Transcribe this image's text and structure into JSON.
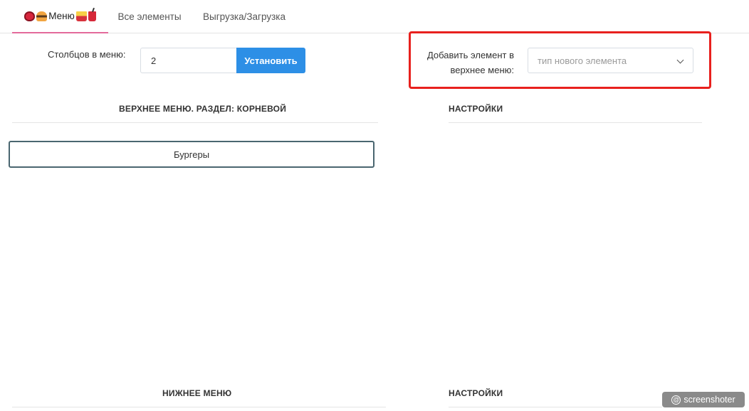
{
  "tabs": [
    {
      "label": "Меню",
      "emoji_left": [
        "steak-icon",
        "burger-icon"
      ],
      "emoji_right": [
        "fries-icon",
        "drink-icon"
      ],
      "active": true
    },
    {
      "label": "Все элементы",
      "active": false
    },
    {
      "label": "Выгрузка/Загрузка",
      "active": false
    }
  ],
  "columns": {
    "label": "Столбцов в меню:",
    "value": "2",
    "button": "Установить"
  },
  "add_element": {
    "label_line1": "Добавить элемент в",
    "label_line2": "верхнее меню:",
    "select_placeholder": "тип нового элемента"
  },
  "top_menu": {
    "header": "ВЕРХНЕЕ МЕНЮ. РАЗДЕЛ: КОРНЕВОЙ",
    "items": [
      "Бургеры"
    ]
  },
  "top_settings": {
    "header": "НАСТРОЙКИ"
  },
  "bottom_menu": {
    "header": "НИЖНЕЕ МЕНЮ"
  },
  "bottom_settings": {
    "header": "НАСТРОЙКИ"
  },
  "watermark": "screenshoter",
  "colors": {
    "accent_blue": "#2d8fe6",
    "tab_underline": "#e36a9b",
    "highlight_red": "#e8211e",
    "item_border": "#4a6670"
  }
}
